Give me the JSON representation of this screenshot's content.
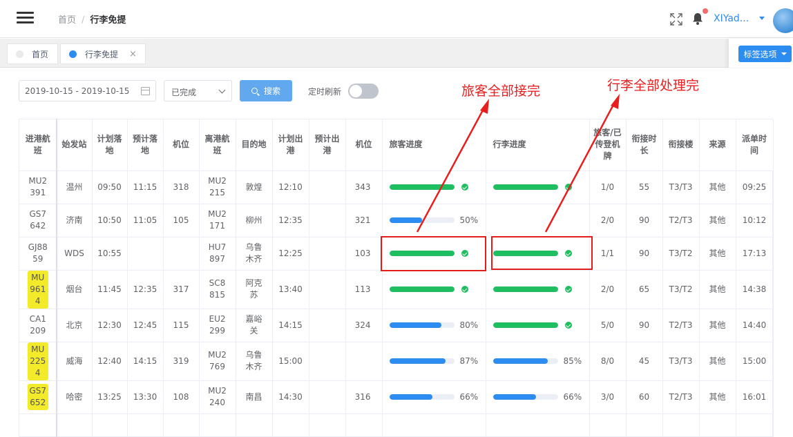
{
  "header": {
    "breadcrumb_home": "首页",
    "breadcrumb_sep": "/",
    "breadcrumb_current": "行李免提",
    "username": "XIYad...",
    "accent": "#2d8cf0"
  },
  "tabs": {
    "items": [
      {
        "label": "首页",
        "active": false
      },
      {
        "label": "行李免提",
        "active": true,
        "close": "×"
      }
    ],
    "options_label": "标签选项"
  },
  "filters": {
    "date_range": "2019-10-15 - 2019-10-15",
    "status_value": "已完成",
    "search_label": "搜索",
    "refresh_label": "定时刷新",
    "refresh_on": false
  },
  "table": {
    "headers": [
      "进港航班",
      "始发站",
      "计划落地",
      "预计落地",
      "机位",
      "离港航班",
      "目的地",
      "计划出港",
      "预计出港",
      "机位",
      "旅客进度",
      "行李进度",
      "旅客/已传登机牌",
      "衔接时长",
      "衔接楼",
      "来源",
      "派单时间"
    ],
    "rows": [
      {
        "in_flight": "MU2391",
        "hl": false,
        "origin": "温州",
        "plan_land": "09:50",
        "est_land": "11:15",
        "stand_in": "318",
        "out_flight": "MU2215",
        "dest": "敦煌",
        "plan_dep": "12:10",
        "est_dep": "",
        "stand_out": "343",
        "pax": 100,
        "pax_text": "",
        "bag": 100,
        "bag_text": "",
        "pax_boarding": "1/0",
        "transfer_time": "55",
        "terminal": "T3/T3",
        "source": "其他",
        "dispatch": "09:25"
      },
      {
        "in_flight": "GS7642",
        "hl": false,
        "origin": "济南",
        "plan_land": "10:50",
        "est_land": "11:05",
        "stand_in": "105",
        "out_flight": "MU2171",
        "dest": "柳州",
        "plan_dep": "12:35",
        "est_dep": "",
        "stand_out": "321",
        "pax": 50,
        "pax_text": "50%",
        "bag": null,
        "bag_text": "",
        "pax_boarding": "2/0",
        "transfer_time": "90",
        "terminal": "T2/T3",
        "source": "其他",
        "dispatch": "10:12"
      },
      {
        "in_flight": "GJ8859",
        "hl": false,
        "origin": "WDS",
        "plan_land": "10:55",
        "est_land": "",
        "stand_in": "",
        "out_flight": "HU7897",
        "dest": "乌鲁木齐",
        "plan_dep": "12:25",
        "est_dep": "",
        "stand_out": "103",
        "pax": 100,
        "pax_text": "",
        "bag": 100,
        "bag_text": "",
        "pax_boarding": "1/1",
        "transfer_time": "90",
        "terminal": "T3/T2",
        "source": "其他",
        "dispatch": "17:13"
      },
      {
        "in_flight": "MU9614",
        "hl": true,
        "origin": "烟台",
        "plan_land": "11:45",
        "est_land": "12:35",
        "stand_in": "317",
        "out_flight": "SC8815",
        "dest": "阿克苏",
        "plan_dep": "13:40",
        "est_dep": "",
        "stand_out": "113",
        "pax": 100,
        "pax_text": "",
        "bag": 100,
        "bag_text": "",
        "pax_boarding": "2/0",
        "transfer_time": "65",
        "terminal": "T3/T2",
        "source": "其他",
        "dispatch": "14:38"
      },
      {
        "in_flight": "CA1209",
        "hl": false,
        "origin": "北京",
        "plan_land": "12:30",
        "est_land": "12:45",
        "stand_in": "115",
        "out_flight": "EU2299",
        "dest": "嘉峪关",
        "plan_dep": "14:15",
        "est_dep": "",
        "stand_out": "324",
        "pax": 80,
        "pax_text": "80%",
        "bag": 100,
        "bag_text": "",
        "pax_boarding": "5/0",
        "transfer_time": "90",
        "terminal": "T2/T3",
        "source": "其他",
        "dispatch": "14:40"
      },
      {
        "in_flight": "MU2254",
        "hl": true,
        "origin": "威海",
        "plan_land": "12:40",
        "est_land": "14:15",
        "stand_in": "319",
        "out_flight": "MU2769",
        "dest": "乌鲁木齐",
        "plan_dep": "15:00",
        "est_dep": "",
        "stand_out": "",
        "pax": 87,
        "pax_text": "87%",
        "bag": 85,
        "bag_text": "85%",
        "pax_boarding": "8/0",
        "transfer_time": "45",
        "terminal": "T3/T3",
        "source": "其他",
        "dispatch": "15:00"
      },
      {
        "in_flight": "GS7652",
        "hl": true,
        "origin": "哈密",
        "plan_land": "13:25",
        "est_land": "13:30",
        "stand_in": "108",
        "out_flight": "MU2240",
        "dest": "南昌",
        "plan_dep": "14:30",
        "est_dep": "",
        "stand_out": "316",
        "pax": 66,
        "pax_text": "66%",
        "bag": 66,
        "bag_text": "66%",
        "pax_boarding": "3/0",
        "transfer_time": "60",
        "terminal": "T2/T3",
        "source": "其他",
        "dispatch": "16:01"
      }
    ]
  },
  "annotations": {
    "pax_done": "旅客全部接完",
    "bag_done": "行李全部处理完",
    "color": "#e81e1e"
  },
  "colors": {
    "complete": "#1fbf61",
    "in_progress": "#2d8cf0",
    "highlight": "#f3eb2a"
  }
}
